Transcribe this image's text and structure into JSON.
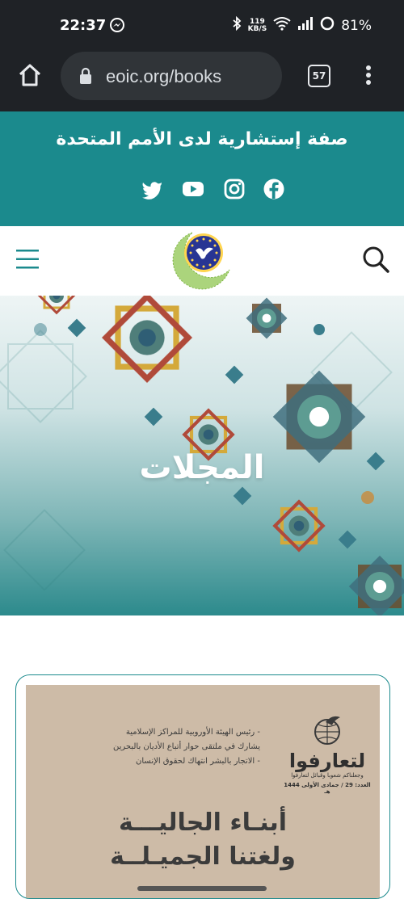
{
  "status_bar": {
    "time": "22:37",
    "net_speed_value": "119",
    "net_speed_unit": "KB/S",
    "battery": "81%"
  },
  "browser": {
    "url": "eoic.org/books",
    "tab_count": "57"
  },
  "banner": {
    "title": "صفة إستشارية لدى الأمم المتحدة",
    "social_icons": [
      "twitter-icon",
      "youtube-icon",
      "instagram-icon",
      "facebook-icon"
    ]
  },
  "hero": {
    "title": "المجلات"
  },
  "magazine": {
    "bullets": [
      "- رئيس الهيئة الأوروبية للمراكز الإسلامية",
      "يشارك في ملتقى حوار أتباع الأديان  بالبحرين",
      "- الاتجار بالبشر انتهاك لحقوق الإنسان"
    ],
    "brand_name": "لتعارفوا",
    "brand_slogan": "وجعلناكم شعوبا وقبائل لتعارفوا",
    "issue": "العدد: 29 / جمادى الأولى 1444 هـ",
    "headline_1": "أبنـاء الجاليـــة",
    "headline_2": "ولغتنا الجميـلــة"
  },
  "colors": {
    "teal": "#1b8a8d",
    "dark": "#1f2226"
  }
}
